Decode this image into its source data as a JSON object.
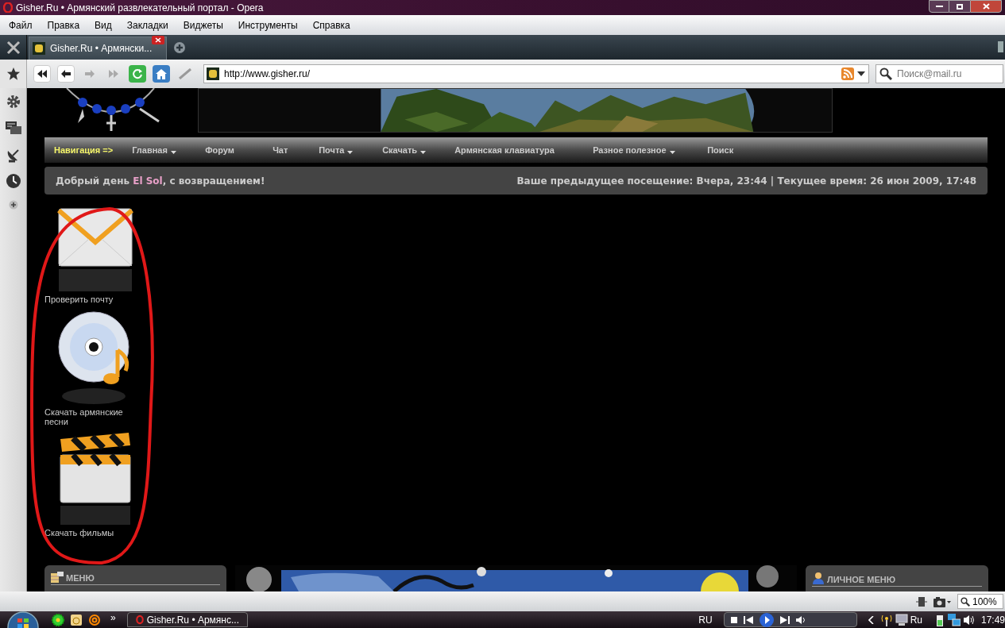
{
  "window": {
    "title": "Gisher.Ru • Армянский развлекательный портал - Opera"
  },
  "menu_bar": [
    "Файл",
    "Правка",
    "Вид",
    "Закладки",
    "Виджеты",
    "Инструменты",
    "Справка"
  ],
  "tabs": [
    {
      "label": "Gisher.Ru • Армянски...",
      "selected": true
    }
  ],
  "address_bar": {
    "url": "http://www.gisher.ru/"
  },
  "search": {
    "placeholder": "Поиск@mail.ru"
  },
  "nav": {
    "label": "Навигация =>",
    "items": [
      {
        "label": "Главная",
        "dropdown": true
      },
      {
        "label": "Форум",
        "dropdown": false
      },
      {
        "label": "Чат",
        "dropdown": false
      },
      {
        "label": "Почта",
        "dropdown": true
      },
      {
        "label": "Скачать",
        "dropdown": true
      },
      {
        "label": "Армянская клавиатура",
        "dropdown": false
      },
      {
        "label": "Разное полезное",
        "dropdown": true
      },
      {
        "label": "Поиск",
        "dropdown": false
      }
    ]
  },
  "greeting": {
    "before": "Добрый день ",
    "user": "El Sol",
    "after": ", с возвращением!",
    "visit_info": "Ваше предыдущее посещение: Вчера, 23:44 | Текущее время: 26 июн 2009, 17:48"
  },
  "shortcuts": [
    {
      "kind": "mail",
      "label": "Проверить почту"
    },
    {
      "kind": "disc",
      "label": "Скачать армянские песни"
    },
    {
      "kind": "clapper",
      "label": "Скачать фильмы"
    }
  ],
  "panels": [
    {
      "title": "МЕНЮ",
      "kind": "menu"
    },
    {
      "title": "ЛИЧНОЕ МЕНЮ",
      "kind": "user"
    }
  ],
  "status_bar": {
    "zoom": "100%"
  },
  "taskbar": {
    "more": "»",
    "task": "Gisher.Ru • Армянс...",
    "language": "RU",
    "tray_language": "Ru",
    "clock": "17:49"
  }
}
